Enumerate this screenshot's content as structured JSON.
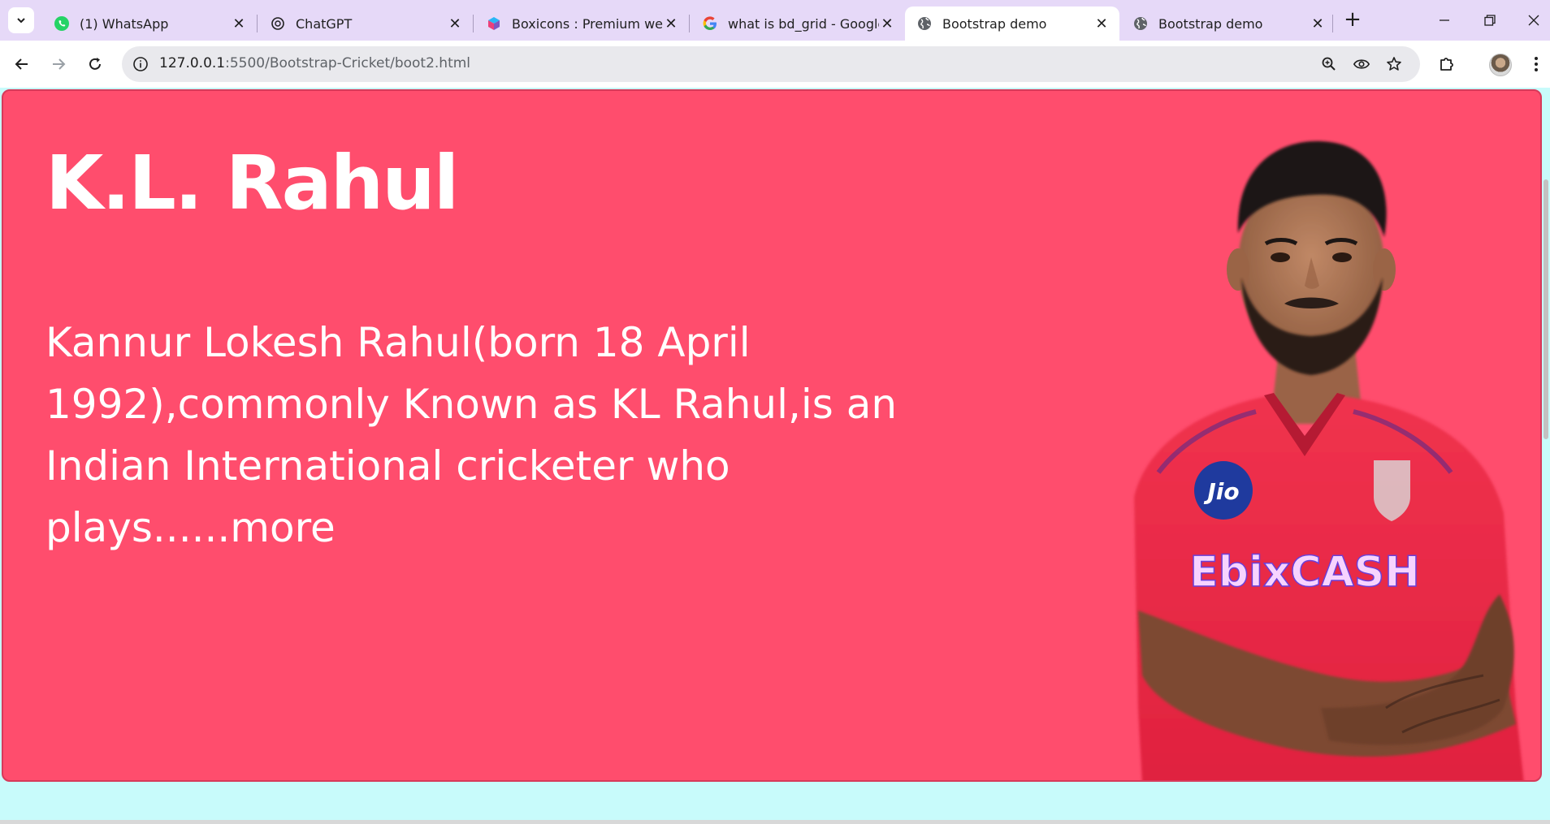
{
  "browser": {
    "tabs": [
      {
        "title": "(1) WhatsApp",
        "icon": "whatsapp-icon",
        "active": false
      },
      {
        "title": "ChatGPT",
        "icon": "chatgpt-icon",
        "active": false
      },
      {
        "title": "Boxicons : Premium web fr",
        "icon": "boxicons-icon",
        "active": false
      },
      {
        "title": "what is bd_grid - Google S",
        "icon": "google-icon",
        "active": false
      },
      {
        "title": "Bootstrap demo",
        "icon": "globe-icon",
        "active": true
      },
      {
        "title": "Bootstrap demo",
        "icon": "globe-icon",
        "active": false
      }
    ],
    "url_host": "127.0.0.1",
    "url_path": ":5500/Bootstrap-Cricket/boot2.html",
    "colors": {
      "tabstrip": "#e6d9f8",
      "omnibox": "#e9e9ed"
    }
  },
  "page": {
    "title": "K.L. Rahul",
    "description": "Kannur Lokesh Rahul(born 18 April 1992),commonly Known as KL Rahul,is an Indian International cricketer who plays......more",
    "colors": {
      "hero_bg": "#ff4d6d",
      "page_bg": "#c8fbfb",
      "text": "#ffffff"
    },
    "jersey_text": "EbixCASH",
    "jersey_badge": "Jio"
  }
}
